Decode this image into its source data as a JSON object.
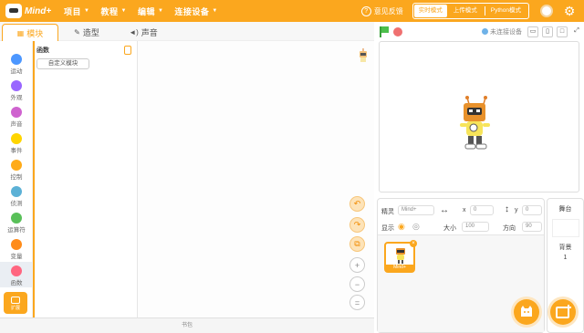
{
  "app": {
    "brand": "Mind+"
  },
  "menu": {
    "items": [
      "项目",
      "教程",
      "编辑",
      "连接设备"
    ],
    "feedback": "意见反馈",
    "modes": [
      "实时模式",
      "上传模式",
      "Python模式"
    ]
  },
  "tabs": [
    {
      "label": "模块",
      "icon": "blocks-icon"
    },
    {
      "label": "造型",
      "icon": "brush-icon"
    },
    {
      "label": "声音",
      "icon": "speaker-icon"
    }
  ],
  "categories": [
    {
      "label": "运动",
      "color": "#4c97ff"
    },
    {
      "label": "外观",
      "color": "#9966ff"
    },
    {
      "label": "声音",
      "color": "#cf63cf"
    },
    {
      "label": "事件",
      "color": "#ffd500"
    },
    {
      "label": "控制",
      "color": "#ffab19"
    },
    {
      "label": "侦测",
      "color": "#5cb1d6"
    },
    {
      "label": "运算符",
      "color": "#59c059"
    },
    {
      "label": "变量",
      "color": "#ff8c1a"
    },
    {
      "label": "函数",
      "color": "#ff6680"
    }
  ],
  "extension": {
    "label": "扩展"
  },
  "palette": {
    "section_title": "函数",
    "make_block": "自定义模块"
  },
  "status_bar": {
    "label": "书包"
  },
  "stage_header": {
    "connection": "未连接设备"
  },
  "sprite_info": {
    "sprite_label": "精灵",
    "sprite_name": "Mind+",
    "x_label": "x",
    "x_value": "0",
    "y_label": "y",
    "y_value": "0",
    "show_label": "显示",
    "size_label": "大小",
    "size_value": "100",
    "direction_label": "方向",
    "direction_value": "90"
  },
  "sprite_list": [
    {
      "name": "Mind+"
    }
  ],
  "stage_panel": {
    "title": "舞台",
    "backdrop_label": "背景",
    "backdrop_count": "1"
  },
  "colors": {
    "accent": "#fba71e"
  }
}
